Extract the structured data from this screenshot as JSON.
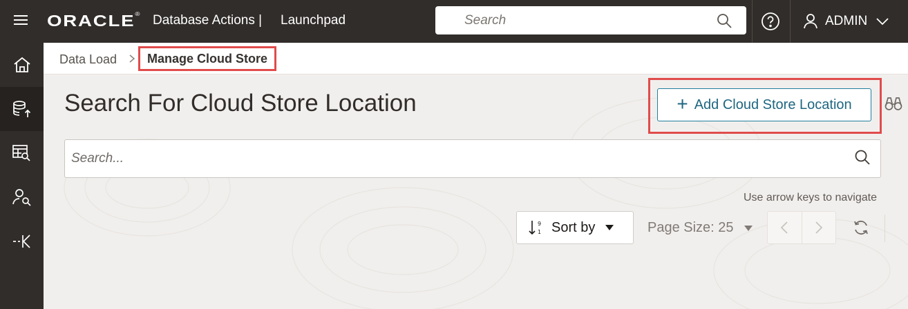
{
  "header": {
    "menu_icon": "hamburger-icon",
    "brand_logo": "ORACLE",
    "app_title": "Database Actions |",
    "page_title": "Launchpad",
    "search_placeholder": "Search",
    "help_icon": "help-circle-icon",
    "user_icon": "user-icon",
    "user_name": "ADMIN",
    "user_chevron_icon": "chevron-down-icon"
  },
  "sidebar": {
    "items": [
      {
        "icon": "home-icon",
        "active": false
      },
      {
        "icon": "database-upload-icon",
        "active": true
      },
      {
        "icon": "table-search-icon",
        "active": false
      },
      {
        "icon": "user-search-icon",
        "active": false
      },
      {
        "icon": "collapse-icon",
        "active": false
      }
    ]
  },
  "breadcrumb": {
    "parent": "Data Load",
    "current": "Manage Cloud Store"
  },
  "main": {
    "title": "Search For Cloud Store Location",
    "add_button_label": "Add Cloud Store Location",
    "search_placeholder": "Search...",
    "nav_hint": "Use arrow keys to navigate",
    "sort_label": "Sort by",
    "page_size_label": "Page Size: 25"
  },
  "colors": {
    "header_bg": "#312d2a",
    "highlight_border": "#e04b4b",
    "button_accent": "#227e9e"
  }
}
